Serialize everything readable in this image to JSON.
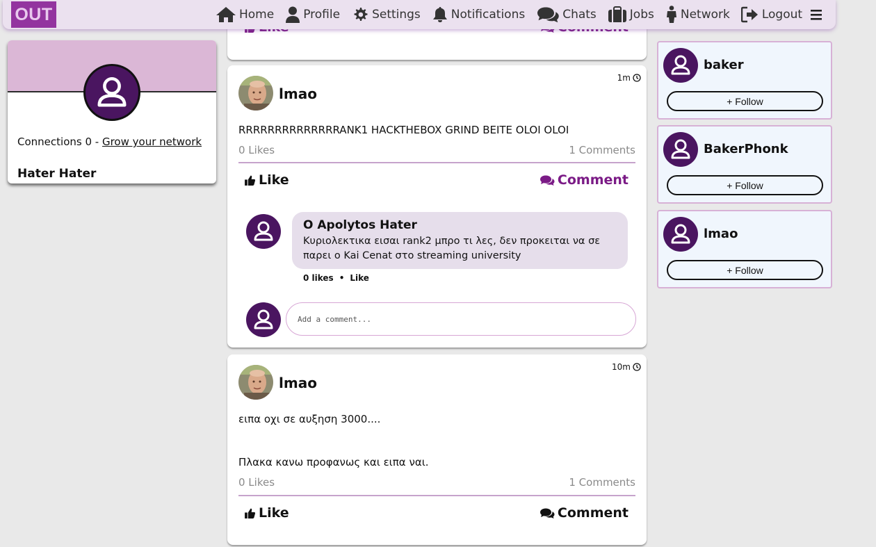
{
  "brand": {
    "logo_text": "OUT",
    "accent": "#93349f",
    "avatar_color": "#4a1560"
  },
  "nav": {
    "items": [
      {
        "label": "Home",
        "icon": "home-icon"
      },
      {
        "label": "Profile",
        "icon": "user-icon"
      },
      {
        "label": "Settings",
        "icon": "gear-icon"
      },
      {
        "label": "Notifications",
        "icon": "bell-icon"
      },
      {
        "label": "Chats",
        "icon": "chat-icon"
      },
      {
        "label": "Jobs",
        "icon": "briefcase-icon"
      },
      {
        "label": "Network",
        "icon": "person-icon"
      },
      {
        "label": "Logout",
        "icon": "logout-icon"
      }
    ],
    "menu_icon": "hamburger-icon"
  },
  "profile": {
    "connections_label": "Connections 0 -",
    "grow_link": "Grow your network",
    "name": "Hater Hater"
  },
  "top_post": {
    "like_label": "Like",
    "comment_label": "Comment"
  },
  "posts": [
    {
      "author": "lmao",
      "time": "1m",
      "text": "RRRRRRRRRRRRRRANK1 HACKTHEBOX GRIND BEITE OLOI OLOI",
      "likes": "0 Likes",
      "comments": "1 Comments",
      "like_label": "Like",
      "comment_label": "Comment",
      "comment": {
        "author": "O Apolytos Hater",
        "text": "Κυριολεκτικα εισαι rank2 μπρο τι λες, δεν προκειται να σε παρει ο Kai Cenat στο streaming university",
        "likes": "0 likes",
        "like_label": "Like"
      },
      "add_comment_placeholder": "Add a comment..."
    },
    {
      "author": "lmao",
      "time": "10m",
      "text_line1": "ειπα οχι σε αυξηση 3000....",
      "text_line2": "Πλακα κανω προφανως και ειπα ναι.",
      "likes": "0 Likes",
      "comments": "1 Comments",
      "like_label": "Like",
      "comment_label": "Comment"
    }
  ],
  "suggestions": [
    {
      "name": "baker",
      "follow_label": "+ Follow"
    },
    {
      "name": "BakerPhonk",
      "follow_label": "+ Follow"
    },
    {
      "name": "lmao",
      "follow_label": "+ Follow"
    }
  ]
}
